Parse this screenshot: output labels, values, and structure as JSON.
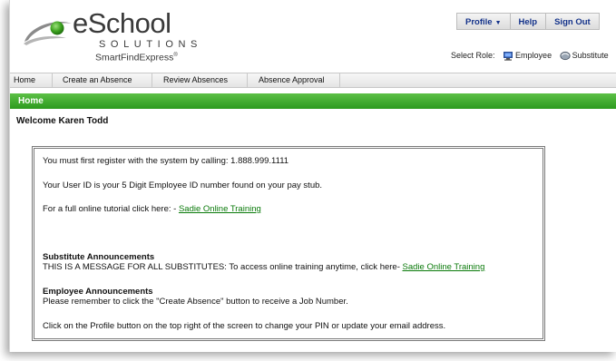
{
  "logo": {
    "brand": "eSchool",
    "line2": "SOLUTIONS",
    "line3": "SmartFindExpress",
    "trademark": "®"
  },
  "top_buttons": {
    "profile": "Profile",
    "help": "Help",
    "sign_out": "Sign Out"
  },
  "role": {
    "label": "Select Role:",
    "employee": "Employee",
    "substitute": "Substitute"
  },
  "nav": {
    "items": [
      "Home",
      "Create an Absence",
      "Review Absences",
      "Absence Approval"
    ]
  },
  "section_title": "Home",
  "welcome": "Welcome Karen Todd",
  "announcements": {
    "register": "You must first register with the system by calling: 1.888.999.1111",
    "user_id": "Your User ID is your 5 Digit Employee ID number found on your pay stub.",
    "tutorial_prefix": "For a full online tutorial click here: - ",
    "tutorial_link": "Sadie Online Training",
    "sub_heading": "Substitute Announcements",
    "sub_text": "THIS IS A MESSAGE FOR ALL SUBSTITUTES: To access online training anytime, click here- ",
    "sub_link": "Sadie Online Training",
    "emp_heading": "Employee Announcements",
    "emp_text": "Please remember to click the \"Create Absence\" button to receive a Job Number.",
    "profile_note": "Click on the Profile button on the top right of the screen to change your PIN or update your email address."
  },
  "colors": {
    "green_bar": "#3aa82a",
    "link_green": "#0a7a0a",
    "button_text": "#13328a"
  }
}
